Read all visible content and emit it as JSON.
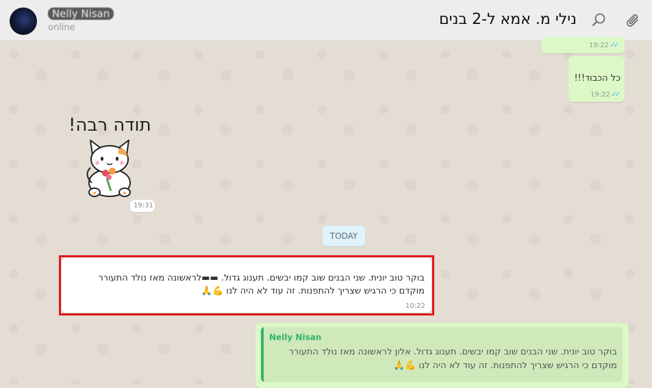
{
  "header": {
    "contact_name": "Nelly Nisan",
    "status": "online",
    "chat_title": "נילי מ. אמא ל-2 בנים",
    "search_icon": "search-icon",
    "attach_icon": "paperclip-icon"
  },
  "messages": {
    "top_out_time": "19:22",
    "kol_hakavod_text": "כל הכבוד!!!",
    "kol_hakavod_time": "19:22",
    "sticker_text": "תודה רבה!",
    "sticker_time": "19:31",
    "date_divider": "TODAY",
    "incoming_line1": "בוקר טוב יונית. שני הבנים שוב קמו יבשים. תענוג גדול. ▬▬לראשונה מאז נולד התעורר",
    "incoming_line2": "מוקדם כי הרגיש שצריך להתפנות. זה עוד לא היה לנו 💪🙏",
    "incoming_time": "10:22",
    "quoted_name": "Nelly Nisan",
    "quoted_line1": "בוקר טוב יונית. שני הבנים שוב קמו יבשים. תענוג גדול. אלון לראשונה מאז נולד התעורר",
    "quoted_line2": "מוקדם כי הרגיש שצריך להתפנות. זה עוד לא היה לנו 💪🙏"
  },
  "colors": {
    "outgoing_bubble": "#dcf8c6",
    "incoming_bubble": "#ffffff",
    "highlight_border": "#e0161b",
    "quote_accent": "#35b36a"
  }
}
